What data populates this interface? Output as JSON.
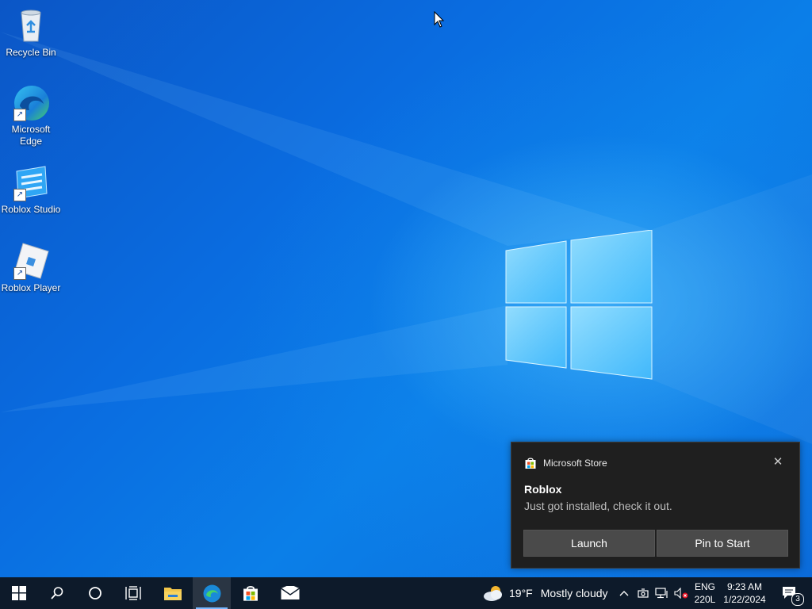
{
  "desktop": {
    "icons": [
      {
        "label": "Recycle Bin",
        "icon": "recycle-bin-icon"
      },
      {
        "label": "Microsoft Edge",
        "icon": "edge-icon"
      },
      {
        "label": "Roblox Studio",
        "icon": "roblox-studio-icon"
      },
      {
        "label": "Roblox Player",
        "icon": "roblox-player-icon"
      }
    ]
  },
  "toast": {
    "app_name": "Microsoft Store",
    "title": "Roblox",
    "body": "Just got installed, check it out.",
    "launch_label": "Launch",
    "pin_label": "Pin to Start",
    "close_glyph": "✕"
  },
  "taskbar": {
    "weather_temp": "19°F",
    "weather_text": "Mostly cloudy",
    "language": "ENG",
    "language_sub": "220L",
    "time": "9:23 AM",
    "date": "1/22/2024",
    "notification_count": "3",
    "apps": [
      "start",
      "search",
      "cortana",
      "task-view",
      "file-explorer",
      "edge",
      "microsoft-store",
      "mail"
    ]
  },
  "colors": {
    "accent": "#78b7ff",
    "toast_bg": "#1f1f1f",
    "taskbar_bg": "#0d1a2a"
  }
}
